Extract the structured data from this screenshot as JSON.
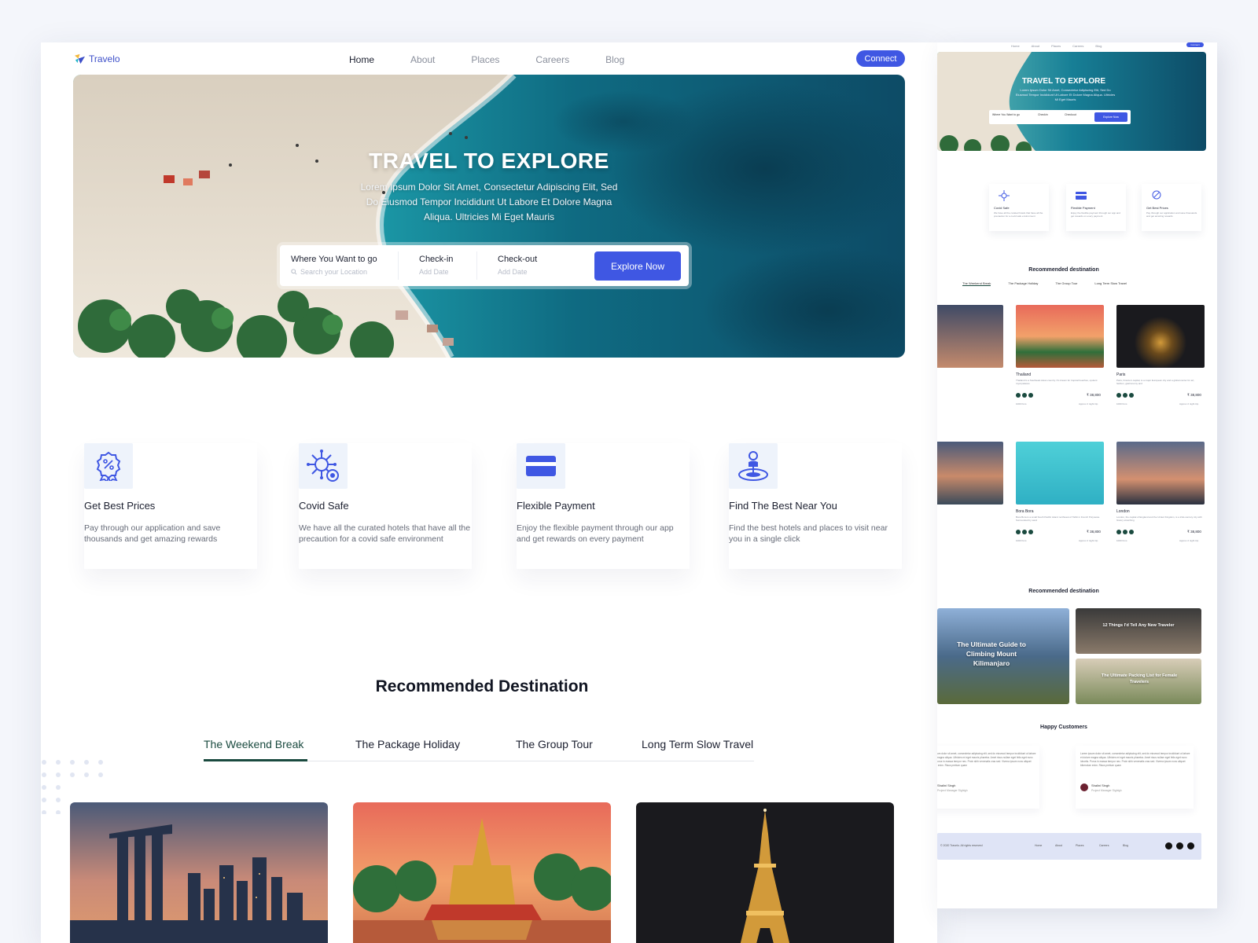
{
  "brand": {
    "name": "Travelo",
    "accent": "#3f57e3",
    "dark_green": "#1a4a3f"
  },
  "nav": {
    "items": [
      "Home",
      "About",
      "Places",
      "Careers",
      "Blog"
    ],
    "active": "Home",
    "connect_label": "Connect"
  },
  "hero": {
    "title": "TRAVEL TO EXPLORE",
    "subtitle": "Lorem Ipsum Dolor Sit Amet, Consectetur Adipiscing Elit, Sed Do Eiusmod Tempor Incididunt Ut Labore Et Dolore Magna Aliqua. Ultricies Mi Eget Mauris",
    "search": {
      "where_label": "Where You Want to go",
      "where_placeholder": "Search your Location",
      "checkin_label": "Check-in",
      "checkin_placeholder": "Add Date",
      "checkout_label": "Check-out",
      "checkout_placeholder": "Add Date",
      "button": "Explore Now"
    }
  },
  "features": [
    {
      "icon": "discount-badge-icon",
      "title": "Get Best Prices",
      "desc": "Pay through our application and save thousands and get amazing rewards"
    },
    {
      "icon": "virus-shield-icon",
      "title": "Covid Safe",
      "desc": "We have all the curated hotels that have all the precaution for a covid safe environment"
    },
    {
      "icon": "credit-card-icon",
      "title": "Flexible Payment",
      "desc": "Enjoy the flexible payment through our app and get rewards on every payment"
    },
    {
      "icon": "location-pin-icon",
      "title": "Find The Best Near You",
      "desc": "Find the best hotels and places to visit near you in a single click"
    }
  ],
  "recommended": {
    "title": "Recommended Destination",
    "tabs": [
      "The Weekend Break",
      "The Package Holiday",
      "The Group Tour",
      "Long Term Slow Travel"
    ],
    "active_tab": "The Weekend Break",
    "cards": [
      "singapore-skyline",
      "thailand-pagoda",
      "paris-eiffel-tower"
    ]
  },
  "preview": {
    "nav_items": [
      "Home",
      "About",
      "Places",
      "Careers",
      "Blog"
    ],
    "connect": "Connect",
    "hero_title": "TRAVEL TO EXPLORE",
    "hero_sub": "Lorem Ipsum Dolor Sit Amet, Consectetur Adipiscing Elit, Sed Do Eiusmod Tempor Incididunt Ut Labore Et Dolore Magna Aliqua. Ultricies Mi Eget Mauris",
    "search_where": "Where You Want to go",
    "search_checkin": "Checkin",
    "search_checkout": "Checkout",
    "search_button": "Explore Now",
    "features": [
      {
        "title": "Covid Safe",
        "desc": "We have all the curated hotels that have all the precaution for a covid safe environment"
      },
      {
        "title": "Flexible Payment",
        "desc": "Enjoy the flexible payment through our app and get rewards on every payment"
      },
      {
        "title": "Get Best Prices",
        "desc": "Pay through our application and save thousands and get amazing rewards"
      }
    ],
    "rec_title": "Recommended destination",
    "tabs": [
      "The Weekend Break",
      "The Package Holiday",
      "The Group Tour",
      "Long Term Slow Travel"
    ],
    "cards": [
      {
        "name": "Thailand",
        "desc": "Thailand is a Southeast Asian country. It's known for tropical beaches, opulent royal palaces",
        "price": "₹ 38,800",
        "distance": "1000 Kms",
        "duration": "Approx 2 night trip"
      },
      {
        "name": "Paris",
        "desc": "Paris, France's capital, is a major European city and a global center for art, fashion, gastronomy and",
        "price": "₹ 38,800",
        "distance": "1000 Kms",
        "duration": "Approx 2 night trip"
      },
      {
        "name": "Bora Bora",
        "desc": "Bora Bora is a small South Pacific island northwest of Tahiti in French Polynesia. Surrounded by sand",
        "price": "₹ 38,800",
        "distance": "1000 Kms",
        "duration": "Approx 2 night trip"
      },
      {
        "name": "London",
        "desc": "London, the capital of England and the United Kingdom, is a 21st-century city with history stretching",
        "price": "₹ 38,800",
        "distance": "1000 Kms",
        "duration": "Approx 2 night trip"
      }
    ],
    "blog_title": "Recommended destination",
    "blogs": [
      "The Ultimate Guide to Climbing Mount Kilimanjaro",
      "12 Things I'd Tell Any New Traveler",
      "The Ultimate Packing List for Female Travelers"
    ],
    "customers_title": "Happy Customers",
    "review_text": "Lorem ipsum dolor sit amet, consectetur adipiscing elit, sed do eiusmod tempor incididunt ut labore et dolore magna aliqua. Ultricies mi eget mauris pharetra. Amet risus nullam eget felis eget nunc lobortis. Purus in massa tempor nec. Proin sibh venenatis cras sed. Viverra ipsum nunc aliquet bibendum enim. Risus pretium quam",
    "reviewer_name": "Shalini Singh",
    "reviewer_role": "Project Manager Sightgh",
    "footer_copy": "© 2020 Travelo. All rights reserved",
    "footer_links": [
      "Home",
      "About",
      "Places",
      "Careers",
      "Blog"
    ]
  }
}
